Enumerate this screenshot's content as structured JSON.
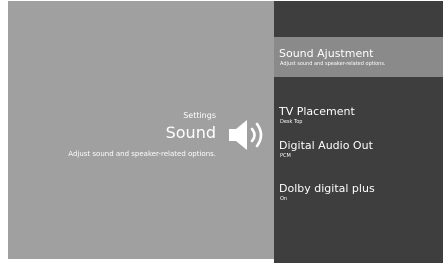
{
  "left": {
    "section_label": "Settings",
    "title": "Sound",
    "description": "Adjust sound and speaker-related options."
  },
  "icons": {
    "speaker": "speaker-volume-icon"
  },
  "colors": {
    "left_bg": "#a0a0a0",
    "right_bg": "#3e3e3e",
    "selected_bg": "#8a8a8a",
    "text": "#ffffff"
  },
  "menu": {
    "items": [
      {
        "title": "Sound Ajustment",
        "subtitle": "Adjust sound and speaker-related options."
      },
      {
        "title": "TV Placement",
        "subtitle": "Desk Top"
      },
      {
        "title": "Digital Audio Out",
        "subtitle": "PCM"
      },
      {
        "title": "Dolby digital plus",
        "subtitle": "On"
      }
    ]
  }
}
